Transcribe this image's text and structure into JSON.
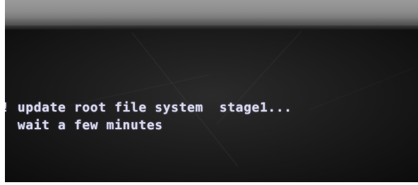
{
  "terminal": {
    "lines": [
      "! update root file system  stage1...",
      "  wait a few minutes"
    ]
  }
}
